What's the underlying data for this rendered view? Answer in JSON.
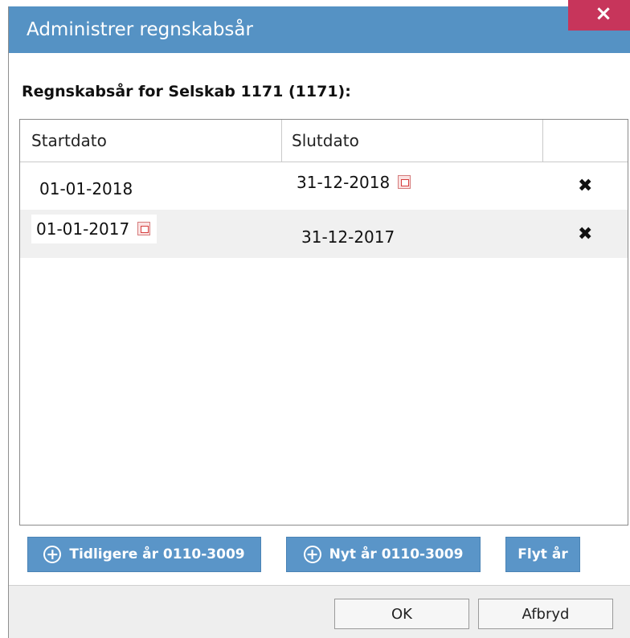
{
  "dialog": {
    "title": "Administrer regnskabsår",
    "close_label": "×"
  },
  "heading": "Regnskabsår for Selskab 1171 (1171):",
  "grid": {
    "columns": [
      "Startdato",
      "Slutdato",
      ""
    ],
    "rows": [
      {
        "start": "01-01-2018",
        "end": "31-12-2018",
        "calendar_on": "end",
        "delete_icon": "✖"
      },
      {
        "start": "01-01-2017",
        "end": "31-12-2017",
        "calendar_on": "start",
        "delete_icon": "✖"
      }
    ],
    "selected_row_color": "#f0f0f0"
  },
  "actions": {
    "earlier_year": "Tidligere år 0110-3009",
    "new_year": "Nyt år 0110-3009",
    "move_year": "Flyt år"
  },
  "footer": {
    "ok": "OK",
    "cancel": "Afbryd"
  },
  "colors": {
    "titlebar": "#5592c4",
    "close": "#c7355b",
    "primary_button": "#5a95c8"
  }
}
